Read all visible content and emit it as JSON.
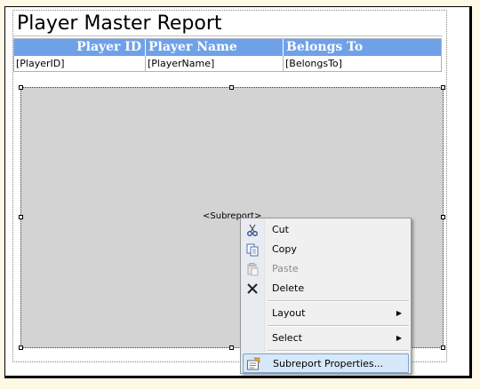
{
  "report": {
    "title": "Player Master Report",
    "columns": [
      "Player ID",
      "Player Name",
      "Belongs To"
    ],
    "fields": [
      "[PlayerID]",
      "[PlayerName]",
      "[BelongsTo]"
    ]
  },
  "subreport": {
    "label": "<Subreport>"
  },
  "context_menu": {
    "items": [
      {
        "label": "Cut",
        "icon": "scissors-icon",
        "enabled": true
      },
      {
        "label": "Copy",
        "icon": "copy-icon",
        "enabled": true
      },
      {
        "label": "Paste",
        "icon": "paste-icon",
        "enabled": false
      },
      {
        "label": "Delete",
        "icon": "delete-x-icon",
        "enabled": true
      },
      {
        "label": "Layout",
        "submenu": true,
        "enabled": true
      },
      {
        "label": "Select",
        "submenu": true,
        "enabled": true
      },
      {
        "label": "Subreport Properties...",
        "icon": "properties-icon",
        "enabled": true,
        "highlighted": true
      }
    ]
  },
  "colors": {
    "header_bg": "#6ea1e8",
    "subreport_bg": "#d3d3d3",
    "menu_highlight": "#d6e8fa"
  }
}
